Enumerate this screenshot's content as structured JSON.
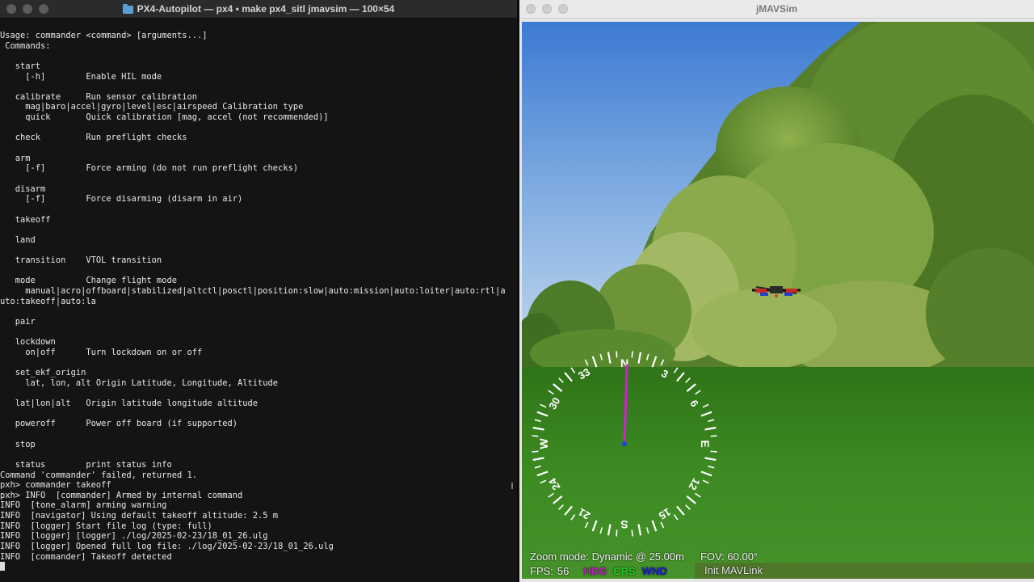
{
  "terminal": {
    "title": "PX4-Autopilot — px4 • make px4_sitl jmavsim — 100×54",
    "lines": [
      "Usage: commander <command> [arguments...]",
      " Commands:",
      "",
      "   start",
      "     [-h]        Enable HIL mode",
      "",
      "   calibrate     Run sensor calibration",
      "     mag|baro|accel|gyro|level|esc|airspeed Calibration type",
      "     quick       Quick calibration [mag, accel (not recommended)]",
      "",
      "   check         Run preflight checks",
      "",
      "   arm",
      "     [-f]        Force arming (do not run preflight checks)",
      "",
      "   disarm",
      "     [-f]        Force disarming (disarm in air)",
      "",
      "   takeoff",
      "",
      "   land",
      "",
      "   transition    VTOL transition",
      "",
      "   mode          Change flight mode",
      "     manual|acro|offboard|stabilized|altctl|posctl|position:slow|auto:mission|auto:loiter|auto:rtl|a",
      "uto:takeoff|auto:la",
      "",
      "   pair",
      "",
      "   lockdown",
      "     on|off      Turn lockdown on or off",
      "",
      "   set_ekf_origin",
      "     lat, lon, alt Origin Latitude, Longitude, Altitude",
      "",
      "   lat|lon|alt   Origin latitude longitude altitude",
      "",
      "   poweroff      Power off board (if supported)",
      "",
      "   stop",
      "",
      "   status        print status info",
      "Command 'commander' failed, returned 1.",
      "pxh> commander takeoff",
      "pxh> INFO  [commander] Armed by internal command",
      "INFO  [tone_alarm] arming warning",
      "INFO  [navigator] Using default takeoff altitude: 2.5 m",
      "INFO  [logger] Start file log (type: full)",
      "INFO  [logger] [logger] ./log/2025-02-23/18_01_26.ulg",
      "INFO  [logger] Opened full log file: ./log/2025-02-23/18_01_26.ulg",
      "INFO  [commander] Takeoff detected"
    ]
  },
  "sim": {
    "title": "jMAVSim",
    "compass": {
      "labels": [
        "N",
        "3",
        "6",
        "E",
        "12",
        "15",
        "S",
        "21",
        "24",
        "W",
        "30",
        "33"
      ],
      "heading_deg": 0
    },
    "hud": {
      "zoom": "Zoom mode: Dynamic @ 25.00m",
      "fov": "FOV: 60.00°"
    },
    "status": {
      "fps_label": "FPS:",
      "fps_value": "56",
      "hdg": "HDG",
      "crs": "CRS",
      "wnd": "WND",
      "message": "Init MAVLink"
    },
    "colors": {
      "sky_top": "#3f7fd6",
      "grass": "#3f8a23",
      "heading_needle": "#d21fd2"
    }
  }
}
